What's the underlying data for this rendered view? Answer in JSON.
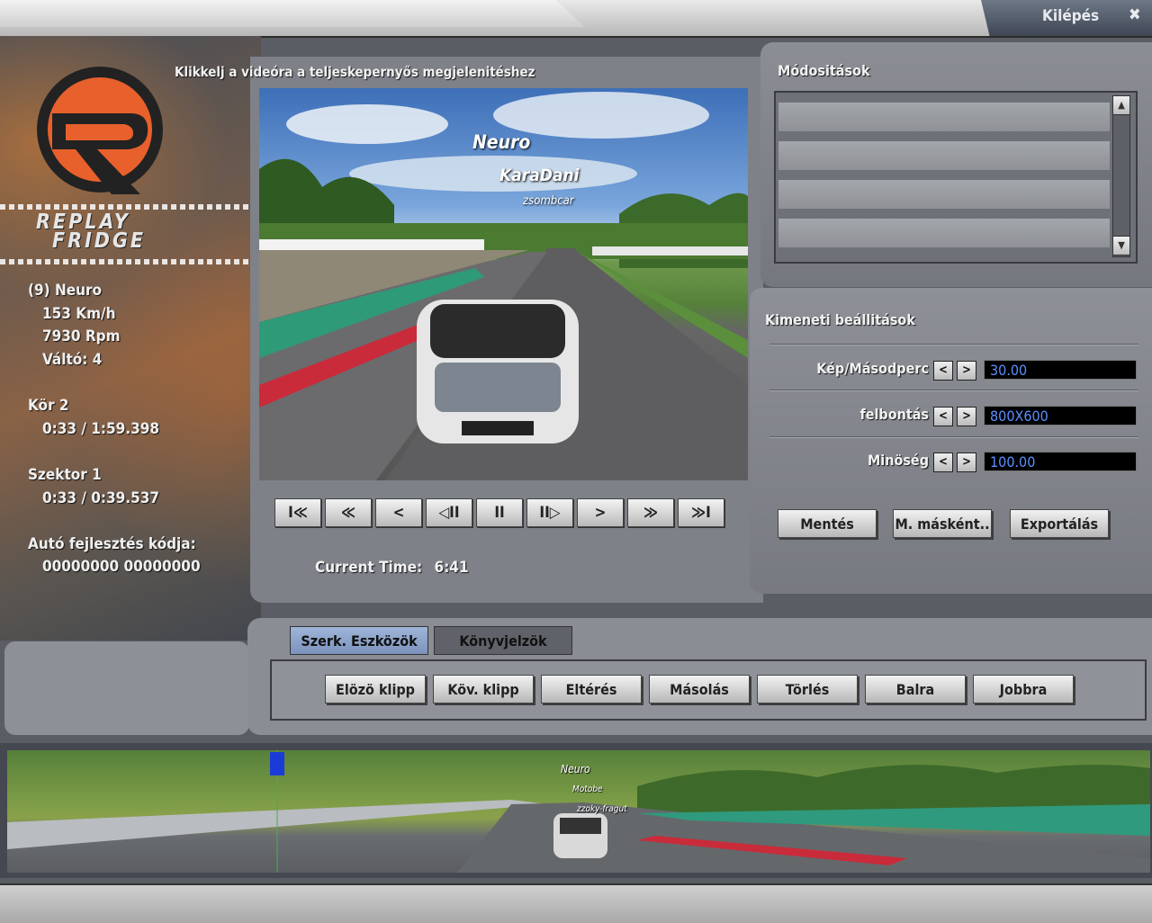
{
  "top_bar": {
    "exit_label": "Kilépés",
    "exit_icon": "✖"
  },
  "logo": {
    "line1": "REPLAY",
    "line2": "FRIDGE"
  },
  "driver_info": {
    "driver": "(9) Neuro",
    "speed": "153 Km/h",
    "rpm": "7930 Rpm",
    "gear": "Váltó: 4",
    "lap_label": "Kör 2",
    "lap_time": "0:33 / 1:59.398",
    "sector_label": "Szektor 1",
    "sector_time": "0:33 / 0:39.537",
    "car_code_label": "Autó fejlesztés kódja:",
    "car_code": "00000000 00000000"
  },
  "video": {
    "caption": "Klikkelj a videóra a teljeskepernyős megjelenitéshez",
    "name_tags": [
      "Neuro",
      "KaraDani",
      "zsombcar"
    ],
    "controls": [
      "I≪",
      "≪",
      "<",
      "◁II",
      "II",
      "II▷",
      ">",
      "≫",
      "≫I"
    ],
    "current_time_label": "Current Time:",
    "current_time_value": "6:41"
  },
  "modifications": {
    "title": "Módositások"
  },
  "output_settings": {
    "title": "Kimeneti beállitások",
    "rows": [
      {
        "label": "Kép/Másodperc",
        "value": "30.00"
      },
      {
        "label": "felbontás",
        "value": "800X600"
      },
      {
        "label": "Minöség",
        "value": "100.00"
      }
    ],
    "buttons": [
      "Mentés",
      "M. másként..",
      "Exportálás"
    ]
  },
  "editing": {
    "tabs": [
      "Szerk. Eszközök",
      "Könyvjelzök"
    ],
    "tools": [
      "Elözö klipp",
      "Köv. klipp",
      "Eltérés",
      "Másolás",
      "Törlés",
      "Balra",
      "Jobbra"
    ]
  },
  "timeline": {
    "name_tags": [
      "Neuro",
      "Motobe",
      "zzoky-fragut"
    ]
  },
  "colors": {
    "field_bg": "#000000",
    "field_text": "#5c8fff",
    "logo_orange": "#e8602c"
  }
}
